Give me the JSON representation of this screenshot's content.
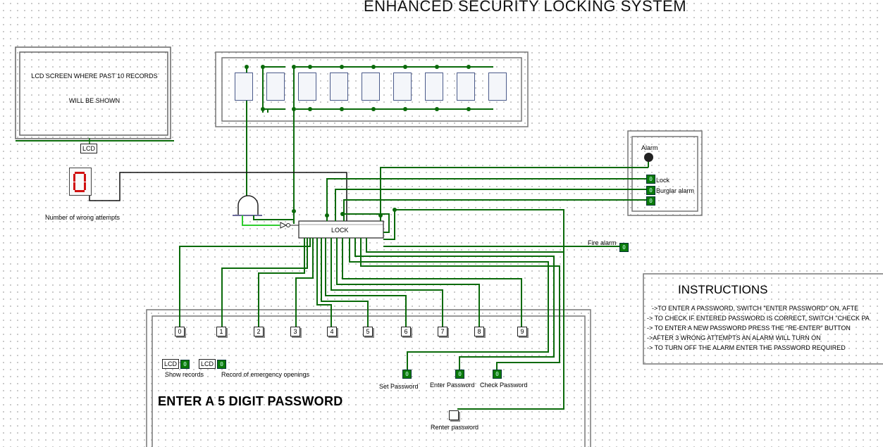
{
  "title": "ENHANCED SECURITY LOCKING SYSTEM",
  "lcd_screen": {
    "line1": "LCD SCREEN WHERE PAST 10 RECORDS",
    "line2": "WILL BE SHOWN",
    "tag": "LCD"
  },
  "wrong_attempts": {
    "label": "Number of wrong attempts"
  },
  "lock_chip": {
    "label": "LOCK"
  },
  "alarm_panel": {
    "alarm": "Alarm",
    "lock": "Lock",
    "burglar": "Burglar alarm"
  },
  "fire_alarm": "Fire alarm",
  "toggle_value": "0",
  "keypad": {
    "heading": "ENTER A 5 DIGIT PASSWORD",
    "digits": [
      "0",
      "1",
      "2",
      "3",
      "4",
      "5",
      "6",
      "7",
      "8",
      "9"
    ],
    "lcd_tag": "LCD",
    "show_records": "Show records",
    "emergency_records": "Record of emergency openings",
    "set_password": "Set Password",
    "enter_password": "Enter Password",
    "check_password": "Check Password",
    "renter_password": "Renter password"
  },
  "instructions": {
    "heading": "INSTRUCTIONS",
    "lines": [
      "->TO ENTER A PASSWORD, SWITCH \"ENTER PASSWORD\" ON, AFTE",
      "-> TO CHECK IF ENTERED PASSWORD IS CORRECT, SWITCH \"CHECK PA",
      "-> TO ENTER A NEW PASSWORD PRESS THE \"RE-ENTER\" BUTTON",
      "->AFTER 3 WRONG ATTEMPTS AN ALARM WILL TURN ON",
      "-> TO TURN OFF THE ALARM ENTER THE PASSWORD REQUIRED"
    ]
  }
}
